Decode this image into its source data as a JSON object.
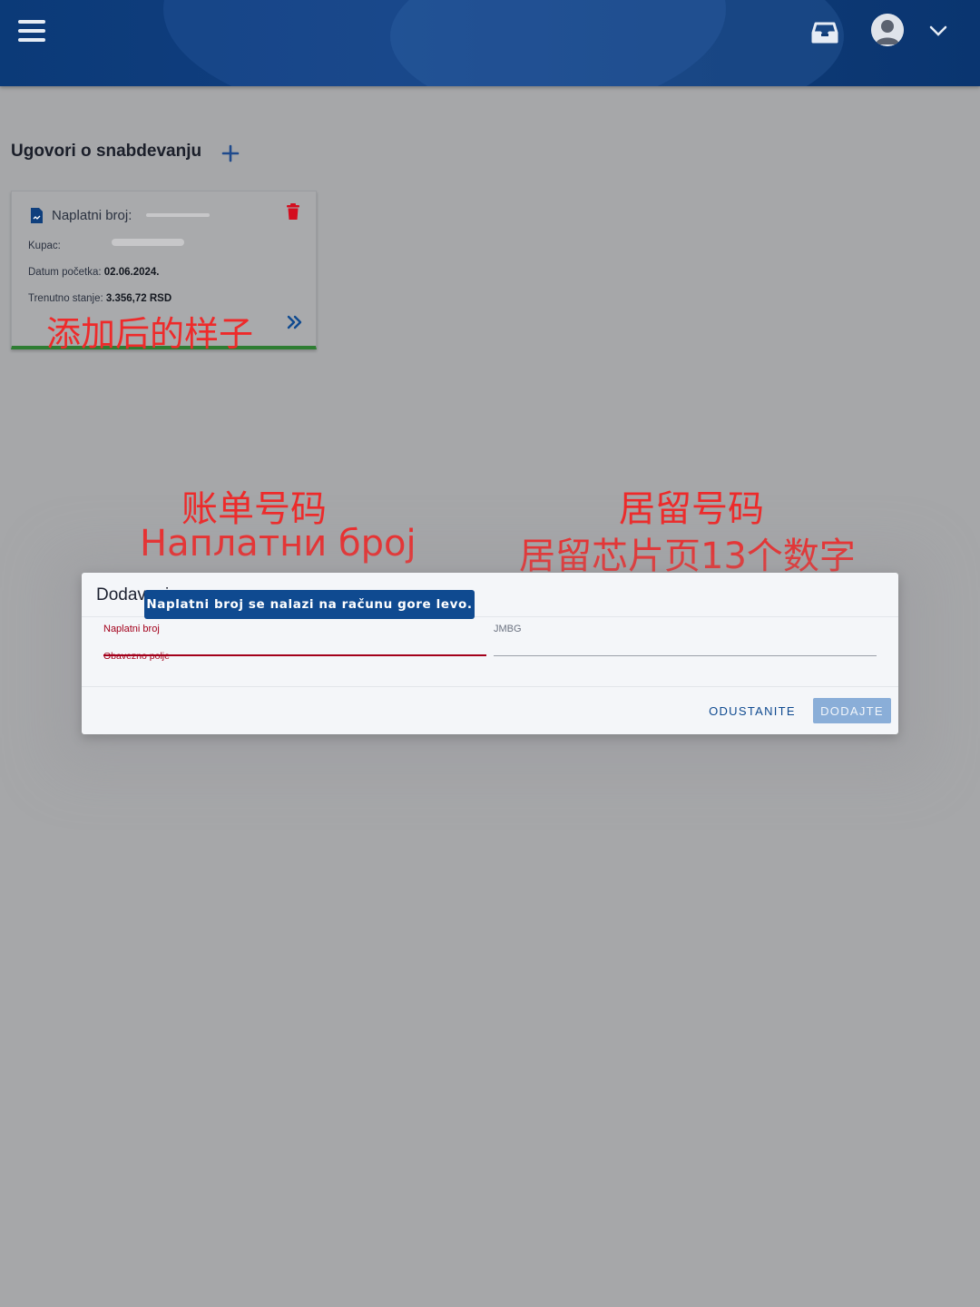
{
  "header": {
    "menu_icon": "hamburger-menu-icon",
    "inbox_icon": "inbox-icon",
    "avatar_icon": "user-avatar-icon",
    "dropdown_icon": "chevron-down-icon"
  },
  "page": {
    "title": "Ugovori o snabdevanju",
    "add_icon": "plus-icon"
  },
  "card": {
    "title_label": "Naplatni broj:",
    "buyer_label": "Kupac:",
    "start_label": "Datum početka:",
    "start_value": "02.06.2024.",
    "balance_label": "Trenutno stanje:",
    "balance_value": "3.356,72 RSD",
    "annotation": "添加后的样子",
    "status_color": "#2e7d32"
  },
  "annotations": {
    "bill_cn": "账单号码",
    "bill_sr": "Наплатни број",
    "residence_cn": "居留号码",
    "residence_detail": "居留芯片页13个数字"
  },
  "dialog": {
    "title": "Dodavanje",
    "tooltip": "Naplatni broj se nalazi na računu gore levo.",
    "field1_label": "Naplatni broj",
    "field1_error": "Obavezno polje",
    "field1_value": "",
    "field2_label": "JMBG",
    "field2_value": "",
    "cancel_label": "ODUSTANITE",
    "add_label": "DODAJTE"
  },
  "colors": {
    "brand": "#0f4a90",
    "error": "#a3001b",
    "annotation": "#ee2a2a"
  }
}
